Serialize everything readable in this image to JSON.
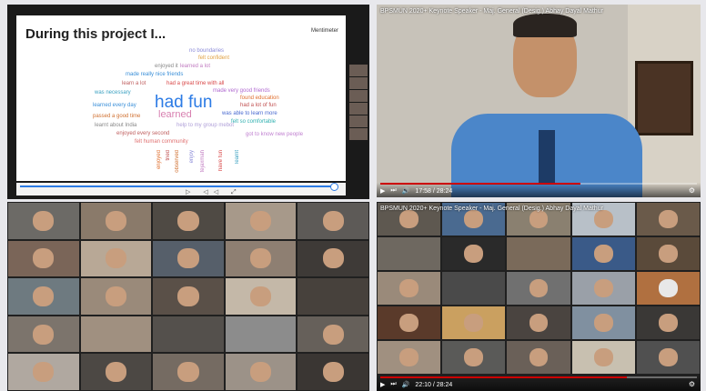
{
  "slide": {
    "title": "During this project I...",
    "brand": "Mentimeter",
    "words": [
      {
        "text": "no boundaries",
        "color": "#8a8ad8",
        "size": 6
      },
      {
        "text": "felt confident",
        "color": "#e0a040",
        "size": 6
      },
      {
        "text": "enjoyed it",
        "color": "#888",
        "size": 6
      },
      {
        "text": "learned a lot",
        "color": "#c07ac0",
        "size": 6
      },
      {
        "text": "made really nice friends",
        "color": "#3a8fd8",
        "size": 6
      },
      {
        "text": "learn a lot",
        "color": "#c06060",
        "size": 6
      },
      {
        "text": "had a great time with all",
        "color": "#d84848",
        "size": 6
      },
      {
        "text": "made very good friends",
        "color": "#b06ad0",
        "size": 6
      },
      {
        "text": "was necessary",
        "color": "#3aa0c0",
        "size": 6
      },
      {
        "text": "had fun",
        "color": "#2c7be5",
        "size": 19
      },
      {
        "text": "found education",
        "color": "#e07030",
        "size": 6
      },
      {
        "text": "had a lot of fun",
        "color": "#c05050",
        "size": 6
      },
      {
        "text": "learned every day",
        "color": "#3a8fd8",
        "size": 6
      },
      {
        "text": "was able to learn more",
        "color": "#4a6ad0",
        "size": 6
      },
      {
        "text": "passed a good time",
        "color": "#d07030",
        "size": 6
      },
      {
        "text": "learned",
        "color": "#d880b0",
        "size": 11
      },
      {
        "text": "felt so comfortable",
        "color": "#30b0b0",
        "size": 6
      },
      {
        "text": "learnt about India",
        "color": "#888",
        "size": 6
      },
      {
        "text": "help to my group mebot",
        "color": "#b0a0d8",
        "size": 6
      },
      {
        "text": "enjoyed every second",
        "color": "#c06060",
        "size": 6
      },
      {
        "text": "got to know new people",
        "color": "#c080d0",
        "size": 6
      },
      {
        "text": "felt human community",
        "color": "#e07070",
        "size": 6
      }
    ],
    "vertical_words": [
      {
        "text": "enjoyed",
        "color": "#e07030"
      },
      {
        "text": "tried",
        "color": "#c05050"
      },
      {
        "text": "observed",
        "color": "#d07030"
      },
      {
        "text": "enjoy",
        "color": "#8a8ad8"
      },
      {
        "text": "tejaxmah",
        "color": "#c07ac0"
      },
      {
        "text": "have fun",
        "color": "#d84848"
      },
      {
        "text": "learnt",
        "color": "#3aa0c0"
      }
    ],
    "controls": "▷ ◁◁ ⤢"
  },
  "speaker_video": {
    "title": "BPSMUN 2020+ Keynote Speaker - Maj. General (Desig.) Abhay Dayal Mathur",
    "time": "17:58 / 28:24",
    "progress": 0.633,
    "play_icon": "▶",
    "next_icon": "⏭",
    "volume_icon": "🔊",
    "chevron_icon": "⌄",
    "settings_icon": "⚙"
  },
  "grid_video": {
    "title": "BPSMUN 2020+ Keynote Speaker - Maj. General (Desig.) Abhay Dayal Mathur",
    "time": "22:10 / 28:24",
    "progress": 0.78,
    "play_icon": "▶",
    "next_icon": "⏭",
    "volume_icon": "🔊",
    "settings_icon": "⚙"
  },
  "left_grid_colors": [
    "#6c6a66",
    "#8a7a6a",
    "#4f4a44",
    "#a7998a",
    "#5d5a57",
    "#7a6558",
    "#b8a896",
    "#565f6a",
    "#8e7f72",
    "#3e3a37",
    "#6e7a80",
    "#9a8a7a",
    "#5a5048",
    "#c4b8a8",
    "#47413c",
    "#7c746c",
    "#a09080",
    "#54504c",
    "#8c8c8c",
    "#66605a",
    "#b0a8a0",
    "#4c4844",
    "#756b62",
    "#9c9288",
    "#3a3633"
  ],
  "right_grid_colors": [
    "#5e5850",
    "#4a6a90",
    "#8a8070",
    "#b8c0c8",
    "#6a5a4a",
    "#6e6860",
    "#2a2a2a",
    "#7a6a5a",
    "#3a5a88",
    "#5a4a3a",
    "#9a8a7a",
    "#4a4a4a",
    "#707070",
    "#9aa0a8",
    "#b07040",
    "#5a3a2a",
    "#caa060",
    "#4a4440",
    "#8090a0",
    "#3a3836",
    "#a09080",
    "#5a5a58",
    "#6a6058",
    "#c8c0b0",
    "#505050",
    "#b0a070",
    "#2a2a2a",
    "#8a7a6a",
    "#555",
    "#6a5040"
  ]
}
